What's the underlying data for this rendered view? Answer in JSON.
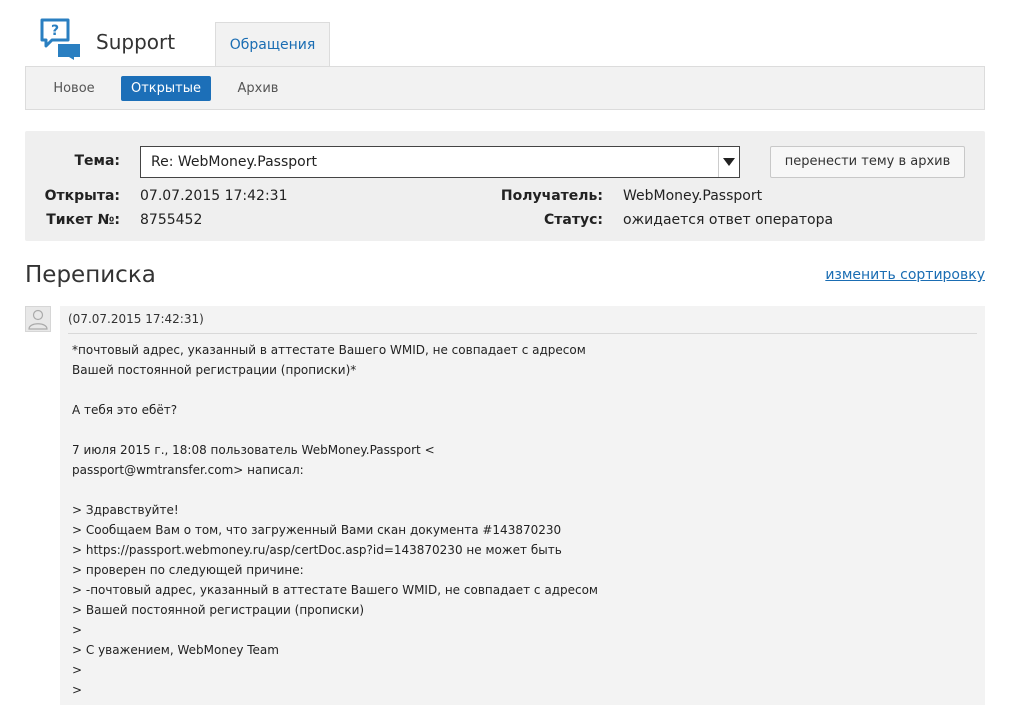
{
  "header": {
    "app_title": "Support",
    "logo_icon": "chat-question-icon",
    "tab_label": "Обращения"
  },
  "subnav": {
    "items": [
      {
        "label": "Новое",
        "active": false
      },
      {
        "label": "Открытые",
        "active": true
      },
      {
        "label": "Архив",
        "active": false
      }
    ]
  },
  "ticket": {
    "topic_label": "Тема:",
    "topic_value": "Re: WebMoney.Passport",
    "archive_button": "перенести тему в архив",
    "opened_label": "Открыта:",
    "opened_value": "07.07.2015 17:42:31",
    "ticket_label": "Тикет №:",
    "ticket_value": "8755452",
    "recipient_label": "Получатель:",
    "recipient_value": "WebMoney.Passport",
    "status_label": "Статус:",
    "status_value": "ожидается ответ оператора"
  },
  "correspondence": {
    "title": "Переписка",
    "sort_link": "изменить сортировку",
    "messages": [
      {
        "date": "(07.07.2015 17:42:31)",
        "body": "*почтовый адрес, указанный в аттестате Вашего WMID, не совпадает с адресом\nВашей постоянной регистрации (прописки)*\n\nА тебя это ебёт?\n\n7 июля 2015 г., 18:08 пользователь WebMoney.Passport <\npassport@wmtransfer.com> написал:\n\n> Здравствуйте!\n> Сообщаем Вам о том, что загруженный Вами скан документа #143870230\n> https://passport.webmoney.ru/asp/certDoc.asp?id=143870230 не может быть\n> проверен по следующей причине:\n> -почтовый адрес, указанный в аттестате Вашего WMID, не совпадает с адресом\n> Вашей постоянной регистрации (прописки)\n>\n> С уважением, WebMoney Team\n>\n>"
      }
    ]
  },
  "colors": {
    "accent": "#1c6fb8",
    "link": "#1a6db3",
    "panel_bg": "#efefef",
    "logo": "#2a7fc1"
  }
}
